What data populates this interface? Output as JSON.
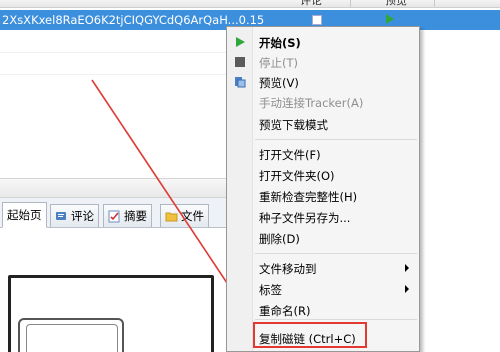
{
  "list": {
    "headers": [
      "评论",
      "预览"
    ],
    "selected_row": {
      "name": "2XsXKxel8RaEO6K2tjCIQGYCdQ6ArQaH...0.15"
    }
  },
  "tabs": [
    {
      "label": "起始页",
      "icon": "home-page-icon"
    },
    {
      "label": "评论",
      "icon": "comment-icon"
    },
    {
      "label": "摘要",
      "icon": "summary-icon"
    },
    {
      "label": "文件",
      "icon": "folder-icon"
    }
  ],
  "context_menu": {
    "items": [
      {
        "label": "开始(S)",
        "bold": true,
        "disabled": false,
        "icon": "play-icon"
      },
      {
        "label": "停止(T)",
        "bold": false,
        "disabled": true,
        "icon": "stop-icon"
      },
      {
        "label": "预览(V)",
        "bold": false,
        "disabled": false,
        "icon": "preview-icon"
      },
      {
        "label": "手动连接Tracker(A)",
        "bold": false,
        "disabled": true,
        "icon": ""
      },
      {
        "label": "预览下载模式",
        "bold": false,
        "disabled": false,
        "icon": ""
      },
      {
        "label": "打开文件(F)",
        "bold": false,
        "disabled": false,
        "icon": ""
      },
      {
        "label": "打开文件夹(O)",
        "bold": false,
        "disabled": false,
        "icon": ""
      },
      {
        "label": "重新检查完整性(H)",
        "bold": false,
        "disabled": false,
        "icon": ""
      },
      {
        "label": "种子文件另存为...",
        "bold": false,
        "disabled": false,
        "icon": ""
      },
      {
        "label": "删除(D)",
        "bold": false,
        "disabled": false,
        "icon": ""
      },
      {
        "label": "文件移动到",
        "bold": false,
        "disabled": false,
        "icon": "",
        "submenu": true
      },
      {
        "label": "标签",
        "bold": false,
        "disabled": false,
        "icon": "",
        "submenu": true
      },
      {
        "label": "重命名(R)",
        "bold": false,
        "disabled": false,
        "icon": ""
      },
      {
        "label": "复制磁链 (Ctrl+C)",
        "bold": false,
        "disabled": false,
        "icon": ""
      }
    ]
  },
  "colors": {
    "selection": "#3c8fdc",
    "annotation_red": "#e03a32",
    "play_green": "#2ea83a"
  }
}
